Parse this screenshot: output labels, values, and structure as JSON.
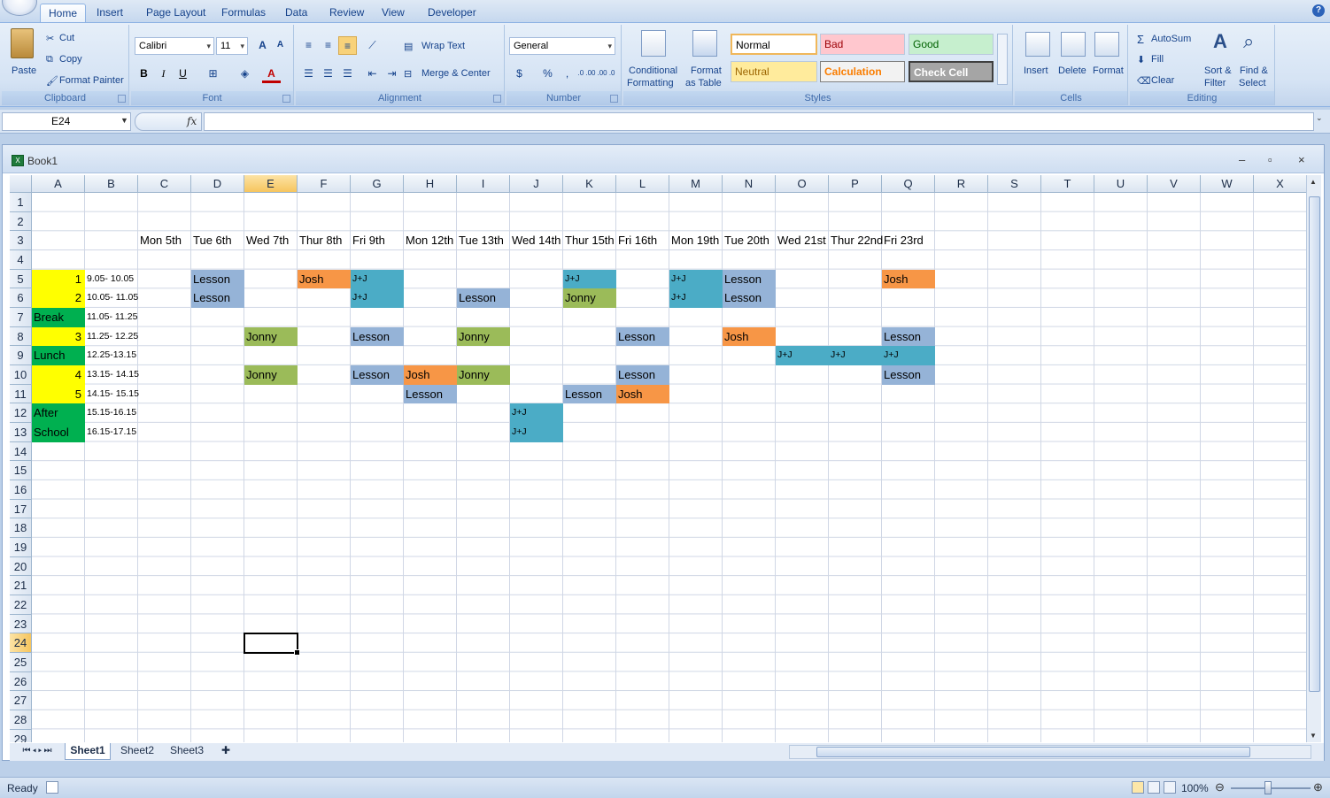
{
  "ribbon_tabs": [
    "Home",
    "Insert",
    "Page Layout",
    "Formulas",
    "Data",
    "Review",
    "View",
    "Developer"
  ],
  "clipboard": {
    "paste": "Paste",
    "cut": "Cut",
    "copy": "Copy",
    "format_painter": "Format Painter",
    "label": "Clipboard"
  },
  "font": {
    "name": "Calibri",
    "size": "11",
    "bold": "B",
    "italic": "I",
    "underline": "U",
    "grow": "A",
    "shrink": "A",
    "font_color": "A",
    "label": "Font"
  },
  "alignment": {
    "wrap": "Wrap Text",
    "merge": "Merge & Center",
    "label": "Alignment"
  },
  "number": {
    "format": "General",
    "percent": "%",
    "comma": ",",
    "inc_dec": ".0 .00",
    "dec_dec": ".00 .0",
    "label": "Number"
  },
  "styles": {
    "conditional": "Conditional",
    "conditional2": "Formatting",
    "format_table": "Format",
    "format_table2": "as Table",
    "normal": "Normal",
    "bad": "Bad",
    "good": "Good",
    "neutral": "Neutral",
    "calculation": "Calculation",
    "check": "Check Cell",
    "label": "Styles"
  },
  "cells": {
    "insert": "Insert",
    "delete": "Delete",
    "format": "Format",
    "label": "Cells"
  },
  "editing": {
    "autosum": "AutoSum",
    "fill": "Fill",
    "clear": "Clear",
    "sort": "Sort &",
    "sort2": "Filter",
    "find": "Find &",
    "find2": "Select",
    "label": "Editing"
  },
  "formula_bar": {
    "name_box": "E24",
    "fx": "fx",
    "formula": ""
  },
  "workbook": {
    "title": "Book1",
    "minimize": "–",
    "restore": "▫",
    "close": "×"
  },
  "columns": [
    "A",
    "B",
    "C",
    "D",
    "E",
    "F",
    "G",
    "H",
    "I",
    "J",
    "K",
    "L",
    "M",
    "N",
    "O",
    "P",
    "Q",
    "R",
    "S",
    "T",
    "U",
    "V",
    "W",
    "X"
  ],
  "rows": [
    "1",
    "2",
    "3",
    "4",
    "5",
    "6",
    "7",
    "8",
    "9",
    "10",
    "11",
    "12",
    "13",
    "14",
    "15",
    "16",
    "17",
    "18",
    "19",
    "20",
    "21",
    "22",
    "23",
    "24",
    "25",
    "26",
    "27",
    "28",
    "29"
  ],
  "selected_cell": "E24",
  "colors": {
    "yellow": "#ffff00",
    "green": "#00b050",
    "blue": "#95b3d7",
    "teal": "#4bacc6",
    "orange": "#f79646",
    "olive": "#9bbb59"
  },
  "cells_data": [
    {
      "row": 3,
      "col": "C",
      "text": "Mon 5th"
    },
    {
      "row": 3,
      "col": "D",
      "text": "Tue 6th"
    },
    {
      "row": 3,
      "col": "E",
      "text": "Wed 7th"
    },
    {
      "row": 3,
      "col": "F",
      "text": "Thur 8th"
    },
    {
      "row": 3,
      "col": "G",
      "text": "Fri 9th"
    },
    {
      "row": 3,
      "col": "H",
      "text": "Mon 12th"
    },
    {
      "row": 3,
      "col": "I",
      "text": "Tue 13th"
    },
    {
      "row": 3,
      "col": "J",
      "text": "Wed 14th"
    },
    {
      "row": 3,
      "col": "K",
      "text": "Thur 15th"
    },
    {
      "row": 3,
      "col": "L",
      "text": "Fri 16th"
    },
    {
      "row": 3,
      "col": "M",
      "text": "Mon 19th"
    },
    {
      "row": 3,
      "col": "N",
      "text": "Tue 20th"
    },
    {
      "row": 3,
      "col": "O",
      "text": "Wed 21st"
    },
    {
      "row": 3,
      "col": "P",
      "text": "Thur 22nd"
    },
    {
      "row": 3,
      "col": "Q",
      "text": "Fri 23rd"
    },
    {
      "row": 5,
      "col": "A",
      "text": "1",
      "fill": "yellow",
      "align": "right"
    },
    {
      "row": 5,
      "col": "B",
      "text": "9.05- 10.05",
      "small": true
    },
    {
      "row": 5,
      "col": "D",
      "text": "Lesson",
      "fill": "blue"
    },
    {
      "row": 5,
      "col": "F",
      "text": "Josh",
      "fill": "orange"
    },
    {
      "row": 5,
      "col": "G",
      "text": "J+J",
      "fill": "teal",
      "small": true
    },
    {
      "row": 5,
      "col": "K",
      "text": "J+J",
      "fill": "teal",
      "small": true
    },
    {
      "row": 5,
      "col": "M",
      "text": "J+J",
      "fill": "teal",
      "small": true
    },
    {
      "row": 5,
      "col": "N",
      "text": "Lesson",
      "fill": "blue"
    },
    {
      "row": 5,
      "col": "Q",
      "text": "Josh",
      "fill": "orange"
    },
    {
      "row": 6,
      "col": "A",
      "text": "2",
      "fill": "yellow",
      "align": "right"
    },
    {
      "row": 6,
      "col": "B",
      "text": "10.05- 11.05",
      "small": true
    },
    {
      "row": 6,
      "col": "D",
      "text": "Lesson",
      "fill": "blue"
    },
    {
      "row": 6,
      "col": "G",
      "text": "J+J",
      "fill": "teal",
      "small": true
    },
    {
      "row": 6,
      "col": "I",
      "text": "Lesson",
      "fill": "blue"
    },
    {
      "row": 6,
      "col": "K",
      "text": "Jonny",
      "fill": "olive"
    },
    {
      "row": 6,
      "col": "M",
      "text": "J+J",
      "fill": "teal",
      "small": true
    },
    {
      "row": 6,
      "col": "N",
      "text": "Lesson",
      "fill": "blue"
    },
    {
      "row": 7,
      "col": "A",
      "text": "Break",
      "fill": "green"
    },
    {
      "row": 7,
      "col": "B",
      "text": "11.05- 11.25",
      "small": true
    },
    {
      "row": 8,
      "col": "A",
      "text": "3",
      "fill": "yellow",
      "align": "right"
    },
    {
      "row": 8,
      "col": "B",
      "text": "11.25- 12.25",
      "small": true
    },
    {
      "row": 8,
      "col": "E",
      "text": "Jonny",
      "fill": "olive"
    },
    {
      "row": 8,
      "col": "G",
      "text": "Lesson",
      "fill": "blue"
    },
    {
      "row": 8,
      "col": "I",
      "text": "Jonny",
      "fill": "olive"
    },
    {
      "row": 8,
      "col": "L",
      "text": "Lesson",
      "fill": "blue"
    },
    {
      "row": 8,
      "col": "N",
      "text": "Josh",
      "fill": "orange"
    },
    {
      "row": 8,
      "col": "Q",
      "text": "Lesson",
      "fill": "blue"
    },
    {
      "row": 9,
      "col": "A",
      "text": "Lunch",
      "fill": "green"
    },
    {
      "row": 9,
      "col": "B",
      "text": "12.25-13.15",
      "small": true
    },
    {
      "row": 9,
      "col": "O",
      "text": "J+J",
      "fill": "teal",
      "small": true
    },
    {
      "row": 9,
      "col": "P",
      "text": "J+J",
      "fill": "teal",
      "small": true
    },
    {
      "row": 9,
      "col": "Q",
      "text": "J+J",
      "fill": "teal",
      "small": true
    },
    {
      "row": 10,
      "col": "A",
      "text": "4",
      "fill": "yellow",
      "align": "right"
    },
    {
      "row": 10,
      "col": "B",
      "text": "13.15- 14.15",
      "small": true
    },
    {
      "row": 10,
      "col": "E",
      "text": "Jonny",
      "fill": "olive"
    },
    {
      "row": 10,
      "col": "G",
      "text": "Lesson",
      "fill": "blue"
    },
    {
      "row": 10,
      "col": "H",
      "text": "Josh",
      "fill": "orange"
    },
    {
      "row": 10,
      "col": "I",
      "text": "Jonny",
      "fill": "olive"
    },
    {
      "row": 10,
      "col": "L",
      "text": "Lesson",
      "fill": "blue"
    },
    {
      "row": 10,
      "col": "Q",
      "text": "Lesson",
      "fill": "blue"
    },
    {
      "row": 11,
      "col": "A",
      "text": "5",
      "fill": "yellow",
      "align": "right"
    },
    {
      "row": 11,
      "col": "B",
      "text": "14.15- 15.15",
      "small": true
    },
    {
      "row": 11,
      "col": "H",
      "text": "Lesson",
      "fill": "blue"
    },
    {
      "row": 11,
      "col": "K",
      "text": "Lesson",
      "fill": "blue"
    },
    {
      "row": 11,
      "col": "L",
      "text": "Josh",
      "fill": "orange"
    },
    {
      "row": 12,
      "col": "A",
      "text": "After",
      "fill": "green"
    },
    {
      "row": 12,
      "col": "B",
      "text": "15.15-16.15",
      "small": true
    },
    {
      "row": 12,
      "col": "J",
      "text": "J+J",
      "fill": "teal",
      "small": true
    },
    {
      "row": 13,
      "col": "A",
      "text": "School",
      "fill": "green"
    },
    {
      "row": 13,
      "col": "B",
      "text": "16.15-17.15",
      "small": true
    },
    {
      "row": 13,
      "col": "J",
      "text": "J+J",
      "fill": "teal",
      "small": true
    }
  ],
  "sheet_tabs": [
    "Sheet1",
    "Sheet2",
    "Sheet3"
  ],
  "active_sheet": "Sheet1",
  "status": {
    "text": "Ready",
    "zoom": "100%"
  }
}
